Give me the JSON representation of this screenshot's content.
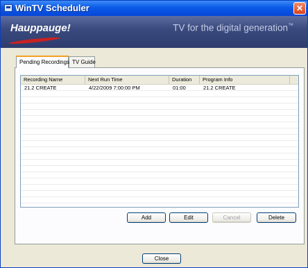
{
  "window": {
    "title": "WinTV Scheduler",
    "close_glyph": "✕"
  },
  "banner": {
    "brand": "Hauppauge!",
    "tagline": "TV for the digital generation",
    "tagline_mark": "™"
  },
  "tabs": [
    {
      "label": "Pending Recordings",
      "active": true
    },
    {
      "label": "TV Guide",
      "active": false
    }
  ],
  "table": {
    "columns": [
      "Recording Name",
      "Next Run Time",
      "Duration",
      "Program Info"
    ],
    "rows": [
      [
        "21.2  CREATE",
        "4/22/2009 7:00:00 PM",
        "01:00",
        "21.2  CREATE"
      ]
    ]
  },
  "buttons": {
    "add": "Add",
    "edit": "Edit",
    "cancel": "Cancel",
    "delete": "Delete",
    "close": "Close"
  },
  "icons": [
    "app-window-icon",
    "close-icon"
  ]
}
